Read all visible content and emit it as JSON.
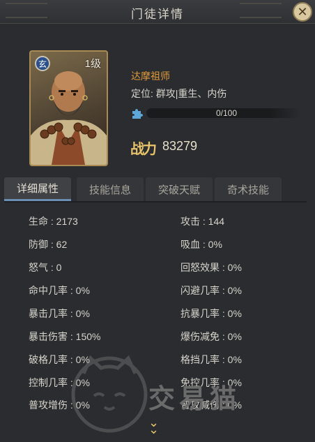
{
  "window": {
    "title": "门徒详情"
  },
  "hero": {
    "name": "达摩祖师",
    "role": "定位: 群攻|重生、内伤",
    "level": "1级",
    "type_badge": "玄",
    "exp_text": "0/100",
    "exp_fraction": 0,
    "power_icon_text": "战力",
    "power_value": "83279"
  },
  "tabs": [
    {
      "label": "详细属性",
      "active": true
    },
    {
      "label": "技能信息",
      "active": false
    },
    {
      "label": "突破天赋",
      "active": false
    },
    {
      "label": "奇术技能",
      "active": false
    }
  ],
  "stats": {
    "left": [
      "生命 : 2173",
      "防御 : 62",
      "怒气 : 0",
      "命中几率 : 0%",
      "暴击几率 : 0%",
      "暴击伤害 : 150%",
      "破格几率 : 0%",
      "控制几率 : 0%",
      "普攻增伤 : 0%"
    ],
    "right": [
      "攻击 : 144",
      "吸血 : 0%",
      "回怒效果 : 0%",
      "闪避几率 : 0%",
      "抗暴几率 : 0%",
      "爆伤减免 : 0%",
      "格挡几率 : 0%",
      "免控几率 : 0%",
      "普攻减伤 : 0%"
    ]
  },
  "watermark": {
    "text": "交易猫"
  },
  "colors": {
    "name": "#e09a3a",
    "accent_gold": "#e8c46a",
    "tab_active_underline": "#6b8fb3"
  },
  "icons": {
    "close": "close-icon",
    "puzzle": "puzzle-piece-icon",
    "scroll": "double-chevron-down-icon"
  }
}
